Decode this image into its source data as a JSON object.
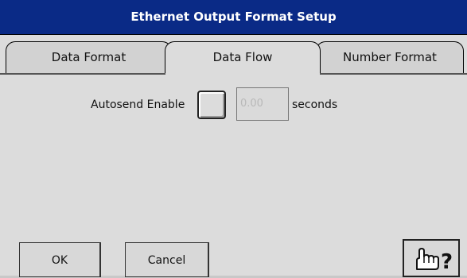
{
  "window": {
    "title": "Ethernet Output Format Setup"
  },
  "tabs": [
    {
      "label": "Data Format",
      "active": false
    },
    {
      "label": "Data Flow",
      "active": true
    },
    {
      "label": "Number Format",
      "active": false
    }
  ],
  "autosend": {
    "label": "Autosend Enable",
    "checked": false,
    "interval_value": "0.00",
    "units_label": "seconds"
  },
  "buttons": {
    "ok_label": "OK",
    "cancel_label": "Cancel",
    "help_icon": "hand-question-icon"
  }
}
